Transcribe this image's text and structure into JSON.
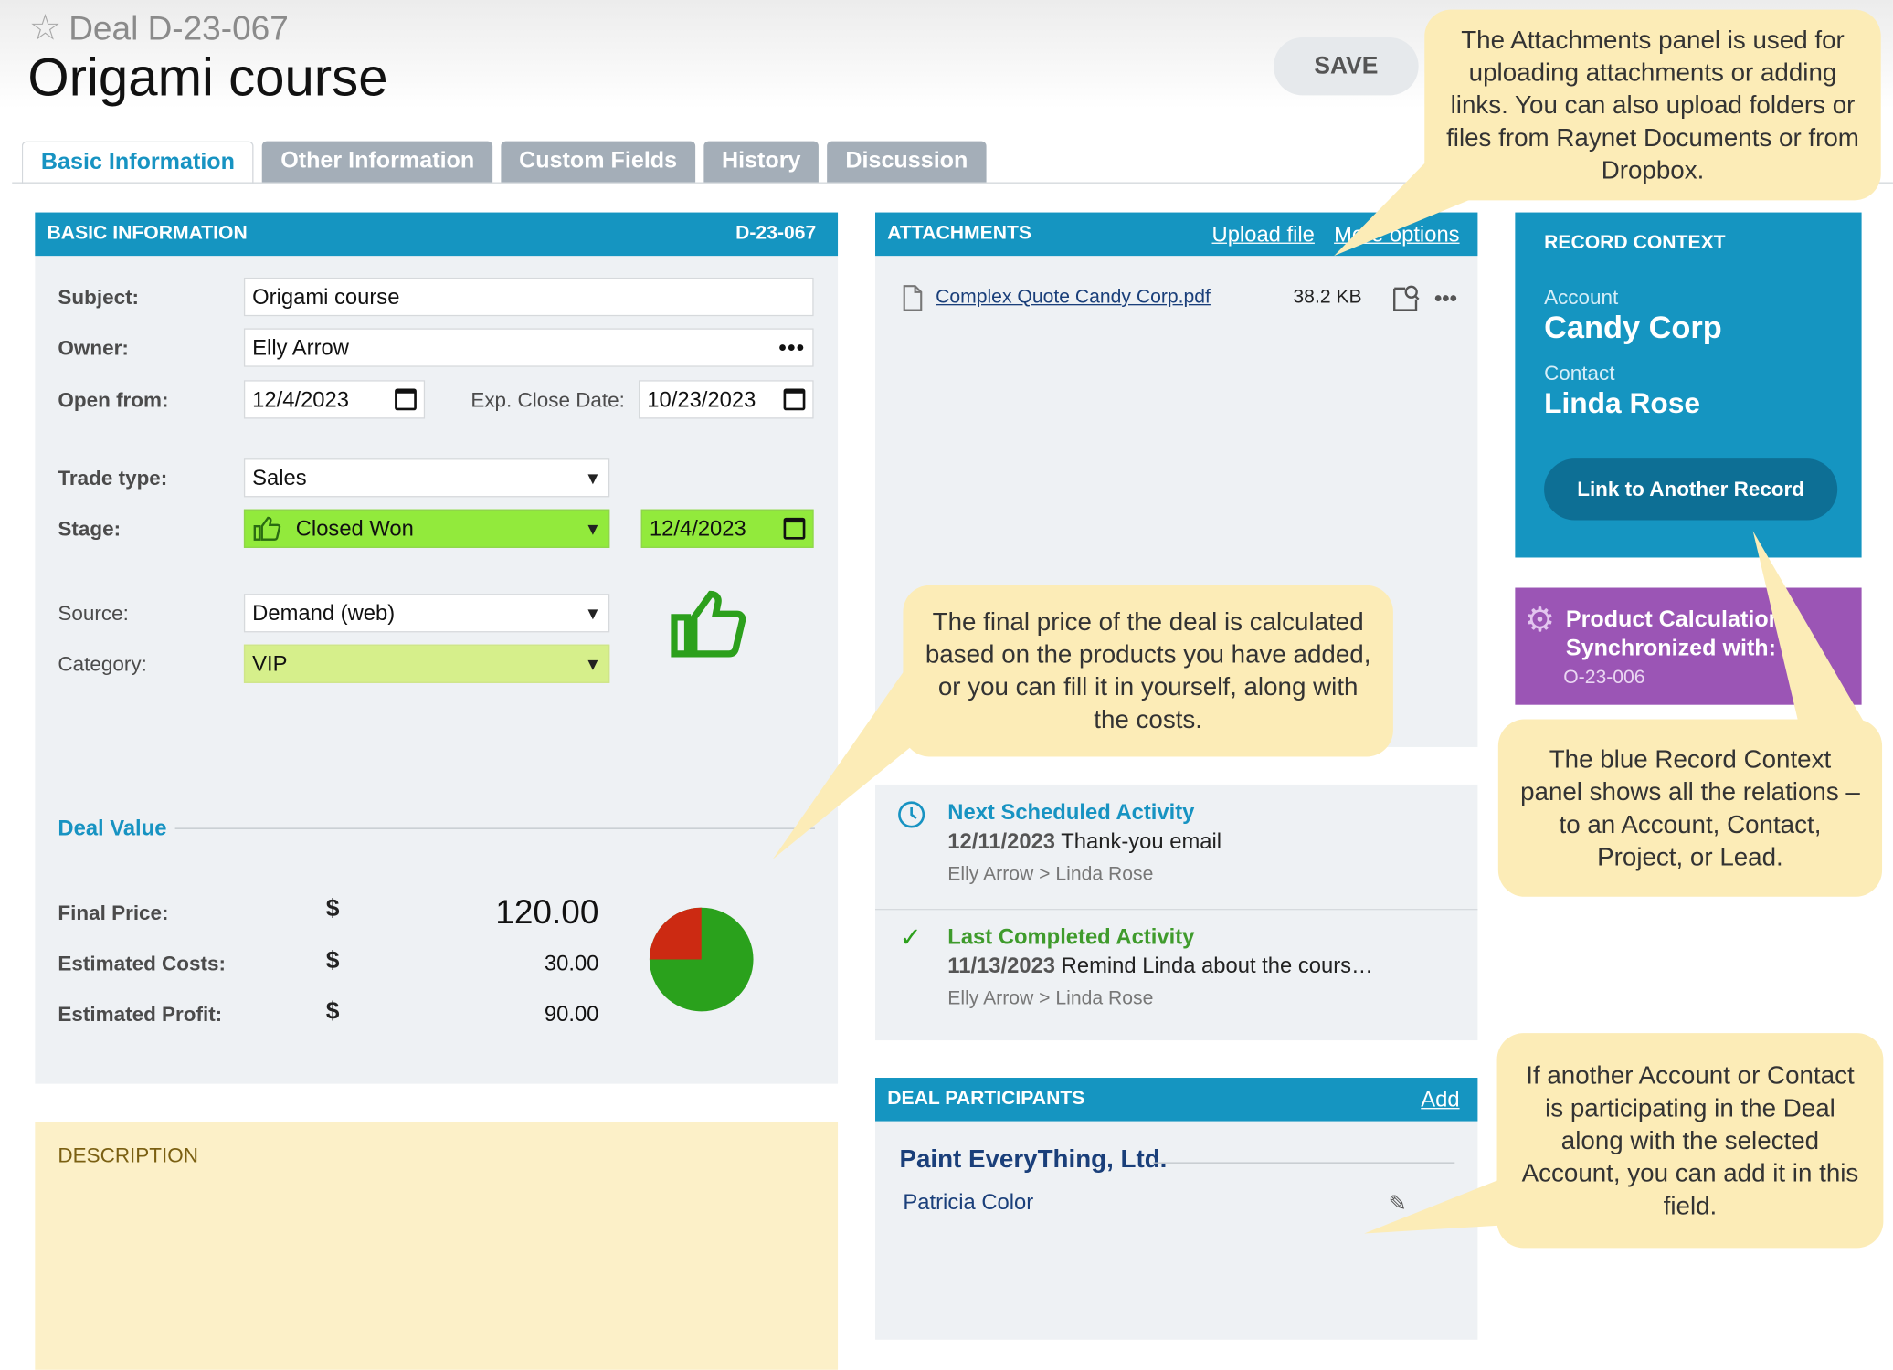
{
  "header": {
    "deal_number": "Deal D-23-067",
    "title": "Origami course",
    "save_label": "SAVE"
  },
  "tabs": [
    {
      "label": "Basic Information",
      "active": true
    },
    {
      "label": "Other Information",
      "active": false
    },
    {
      "label": "Custom Fields",
      "active": false
    },
    {
      "label": "History",
      "active": false
    },
    {
      "label": "Discussion",
      "active": false
    }
  ],
  "basic_info": {
    "header": "BASIC INFORMATION",
    "code": "D-23-067",
    "subject_label": "Subject:",
    "subject_value": "Origami course",
    "owner_label": "Owner:",
    "owner_value": "Elly Arrow",
    "open_from_label": "Open from:",
    "open_from_value": "12/4/2023",
    "exp_close_label": "Exp. Close Date:",
    "exp_close_value": "10/23/2023",
    "trade_type_label": "Trade type:",
    "trade_type_value": "Sales",
    "stage_label": "Stage:",
    "stage_value": "Closed Won",
    "stage_date": "12/4/2023",
    "source_label": "Source:",
    "source_value": "Demand (web)",
    "category_label": "Category:",
    "category_value": "VIP",
    "stage_color": "#92ea3c",
    "category_color": "#d6ef8b"
  },
  "deal_value": {
    "title": "Deal Value",
    "currency": "$",
    "final_price_label": "Final Price:",
    "final_price": "120.00",
    "costs_label": "Estimated Costs:",
    "costs": "30.00",
    "profit_label": "Estimated Profit:",
    "profit": "90.00",
    "pie": {
      "profit_fraction": 0.75,
      "cost_fraction": 0.25,
      "profit_color": "#2aa11c",
      "cost_color": "#cc2a12"
    }
  },
  "description": {
    "label": "DESCRIPTION"
  },
  "attachments": {
    "header": "ATTACHMENTS",
    "upload_label": "Upload file",
    "more_label": "More options",
    "files": [
      {
        "name": "Complex Quote Candy Corp.pdf",
        "size": "38.2 KB"
      }
    ]
  },
  "activities": {
    "next_title": "Next Scheduled Activity",
    "next_date": "12/11/2023",
    "next_text": "Thank-you email",
    "next_people": "Elly Arrow > Linda Rose",
    "last_title": "Last Completed Activity",
    "last_date": "11/13/2023",
    "last_text": "Remind Linda about the cours…",
    "last_people": "Elly Arrow > Linda Rose"
  },
  "participants": {
    "header": "DEAL PARTICIPANTS",
    "add_label": "Add",
    "company": "Paint EveryThing, Ltd.",
    "person": "Patricia Color"
  },
  "record_context": {
    "header": "RECORD CONTEXT",
    "account_label": "Account",
    "account_value": "Candy Corp",
    "contact_label": "Contact",
    "contact_value": "Linda Rose",
    "link_button": "Link to Another Record"
  },
  "product_calc": {
    "line1": "Product Calculation",
    "line2": "Synchronized with:",
    "code": "O-23-006"
  },
  "tips": {
    "attachments": "The Attachments panel is used for uploading attachments or adding links. You can also upload folders or files from Raynet Documents or from Dropbox.",
    "final_price": "The final price of the deal is calculated based on the products you have added, or you can fill it in yourself, along with the costs.",
    "record_context": "The blue Record Context panel shows all the relations – to an Account, Contact, Project, or Lead.",
    "participants": "If another Account or Contact is participating in the Deal along with the selected Account, you can add it in this field."
  },
  "colors": {
    "accent": "#1595c1",
    "tip_bg": "#fcecb7",
    "purple": "#9b55b5"
  }
}
